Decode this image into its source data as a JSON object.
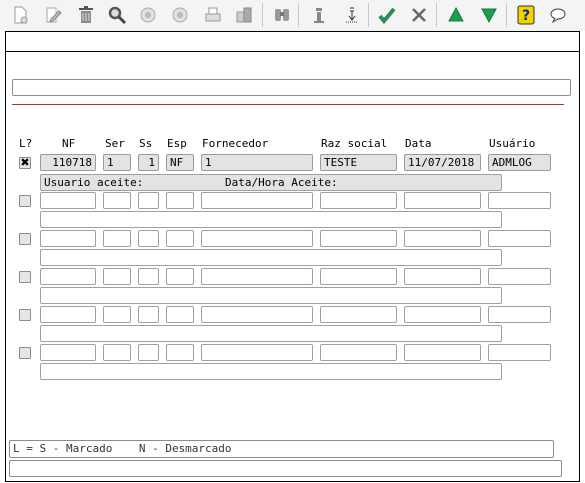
{
  "toolbar": {
    "buttons": [
      {
        "icon": "new-document-icon"
      },
      {
        "icon": "edit-icon"
      },
      {
        "icon": "trash-icon"
      },
      {
        "icon": "search-icon"
      },
      {
        "icon": "previous-icon"
      },
      {
        "icon": "next-icon"
      },
      {
        "icon": "print-icon"
      },
      {
        "icon": "export-icon"
      },
      {
        "icon": "binoculars-icon"
      },
      {
        "icon": "info-icon"
      },
      {
        "icon": "sort-icon"
      },
      {
        "icon": "confirm-icon"
      },
      {
        "icon": "cancel-icon"
      },
      {
        "icon": "arrow-up-icon"
      },
      {
        "icon": "arrow-down-icon"
      },
      {
        "icon": "help-icon"
      },
      {
        "icon": "chat-icon"
      }
    ]
  },
  "headers": {
    "l": "L?",
    "nf": "NF",
    "ser": "Ser",
    "ss": "Ss",
    "esp": "Esp",
    "fornecedor": "Fornecedor",
    "razao": "Raz social",
    "data": "Data",
    "usuario": "Usuário"
  },
  "rows": [
    {
      "checked": "✖",
      "nf": "110718",
      "ser": "1",
      "ss": "1",
      "esp": "NF",
      "fornecedor": "1",
      "razao": "TESTE",
      "data": "11/07/2018",
      "usuario": "ADMLOG",
      "usuario_aceite_label": "Usuario aceite:",
      "data_hora_aceite_label": "Data/Hora Aceite:"
    },
    {
      "checked": ""
    },
    {
      "checked": ""
    },
    {
      "checked": ""
    },
    {
      "checked": ""
    },
    {
      "checked": ""
    }
  ],
  "legend": "L = S - Marcado    N - Desmarcado",
  "colors": {
    "confirm": "#2e8b57",
    "accent_green": "#1e9e50",
    "separator_red": "#b43232",
    "help_yellow": "#f2d200"
  }
}
